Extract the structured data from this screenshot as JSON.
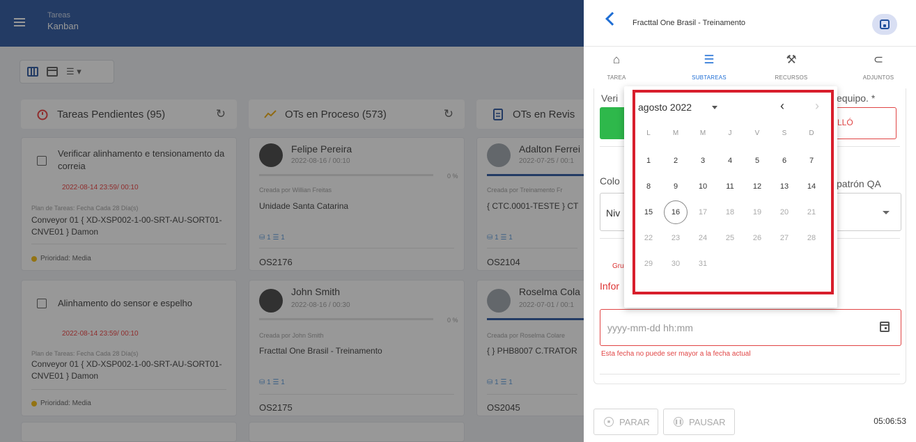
{
  "app": {
    "title": "Tareas",
    "subtitle": "Kanban"
  },
  "toolbar": {
    "list_label": "☰ ▾"
  },
  "columns": [
    {
      "title": "Tareas Pendientes (95)"
    },
    {
      "title": "OTs en Proceso (573)"
    },
    {
      "title": "OTs en Revis"
    }
  ],
  "pending_cards": [
    {
      "title": "Verificar alinhamento e tensionamento da correia",
      "due": "2022-08-14 23:59/ 00:10",
      "plan": "Plan de Tareas: Fecha Cada 28 Día(s)",
      "equipment": "Conveyor 01 { XD-XSP002-1-00-SRT-AU-SORT01-CNVE01 } Damon",
      "priority": "Prioridad: Media"
    },
    {
      "title": "Alinhamento do sensor e espelho",
      "due": "2022-08-14 23:59/ 00:10",
      "plan": "Plan de Tareas: Fecha Cada 28 Día(s)",
      "equipment": "Conveyor 01 { XD-XSP002-1-00-SRT-AU-SORT01-CNVE01 } Damon",
      "priority": "Prioridad: Media"
    }
  ],
  "process_cards": [
    {
      "name": "Felipe Pereira",
      "date": "2022-08-16 / 00:10",
      "progress": "0 %",
      "created": "Creada por Willian Freitas",
      "site": "Unidade Santa Catarina",
      "counts": "⛁ 1 ☰ 1",
      "os": "OS2176"
    },
    {
      "name": "John Smith",
      "date": "2022-08-16 / 00:30",
      "progress": "0 %",
      "created": "Creada por John Smith",
      "site": "Fracttal One Brasil - Treinamento",
      "counts": "⛁ 1 ☰ 1",
      "os": "OS2175"
    }
  ],
  "review_cards": [
    {
      "name": "Adalton Ferrei",
      "date": "2022-07-25 / 00:1",
      "created": "Creada por Treinamento Fr",
      "site": "{ CTC.0001-TESTE } CT",
      "counts": "⛁ 1 ☰ 1",
      "os": "OS2104"
    },
    {
      "name": "Roselma Cola",
      "date": "2022-07-01 / 00:1",
      "created": "Creada por Roselma Colare",
      "site": "{ } PHB8007 C.TRATOR",
      "counts": "⛁ 1 ☰ 1",
      "os": "OS2045"
    }
  ],
  "panel": {
    "title": "Fracttal One Brasil - Treinamento",
    "tabs": [
      "TAREA",
      "SUBTAREAS",
      "RECURSOS",
      "ADJUNTOS"
    ],
    "top_left_label": "Veri",
    "top_right_label": "equipo. *",
    "fail_label": "ALLÓ",
    "colo_label": "Colo",
    "patron_label": "patrón QA",
    "select_value": "Niv",
    "group_label": "Gru",
    "info_label": "Infor",
    "date_placeholder": "yyyy-mm-dd hh:mm",
    "date_error": "Esta fecha no puede ser mayor a la fecha actual",
    "stop_label": "PARAR",
    "pause_label": "PAUSAR",
    "timer": "05:06:53"
  },
  "datepicker": {
    "month_label": "agosto 2022",
    "prev_icon": "‹",
    "next_icon": "›",
    "weekdays": [
      "L",
      "M",
      "M",
      "J",
      "V",
      "S",
      "D"
    ],
    "today": 16,
    "weeks": [
      [
        "1",
        "2",
        "3",
        "4",
        "5",
        "6",
        "7"
      ],
      [
        "8",
        "9",
        "10",
        "11",
        "12",
        "13",
        "14"
      ],
      [
        "15",
        "16",
        "17",
        "18",
        "19",
        "20",
        "21"
      ],
      [
        "22",
        "23",
        "24",
        "25",
        "26",
        "27",
        "28"
      ],
      [
        "29",
        "30",
        "31"
      ]
    ]
  },
  "colors": {
    "header": "#1f4e9c",
    "accent": "#1f6ed4",
    "error": "#e04444",
    "success": "#2eb84b",
    "highlight": "#d81e2c"
  }
}
